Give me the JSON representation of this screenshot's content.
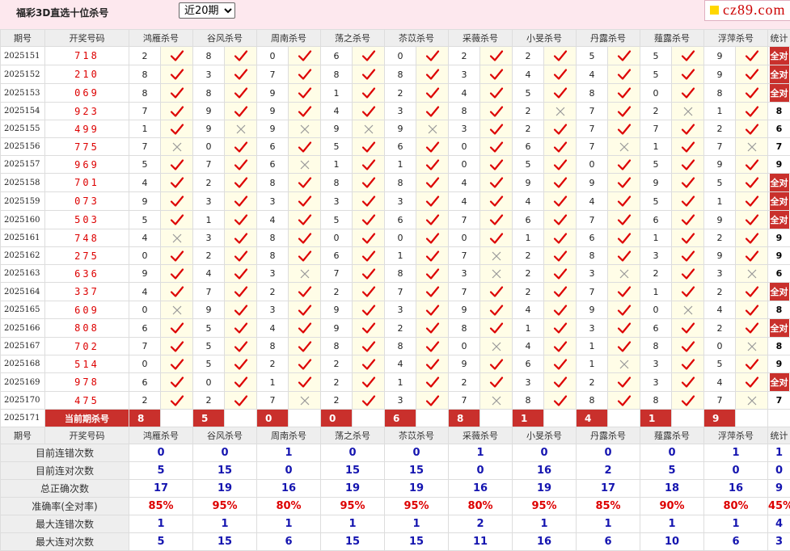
{
  "page": {
    "title": "福彩3D直选十位杀号",
    "period_selected": "近20期",
    "site_logo": "cz89.com"
  },
  "headers": {
    "period": "期号",
    "numbers": "开奖号码",
    "stat": "统计"
  },
  "experts": [
    "鸿雁杀号",
    "谷风杀号",
    "周南杀号",
    "荡之杀号",
    "苶苡杀号",
    "采薇杀号",
    "小旻杀号",
    "丹露杀号",
    "薤露杀号",
    "浮萍杀号"
  ],
  "status_full": "全对",
  "rows": [
    {
      "period": "2025151",
      "numbers": "718",
      "kills": [
        2,
        8,
        0,
        6,
        0,
        2,
        2,
        5,
        5,
        9
      ],
      "hits": [
        1,
        1,
        1,
        1,
        1,
        1,
        1,
        1,
        1,
        1
      ],
      "stat": "全对"
    },
    {
      "period": "2025152",
      "numbers": "210",
      "kills": [
        8,
        3,
        7,
        8,
        8,
        3,
        4,
        4,
        5,
        9
      ],
      "hits": [
        1,
        1,
        1,
        1,
        1,
        1,
        1,
        1,
        1,
        1
      ],
      "stat": "全对"
    },
    {
      "period": "2025153",
      "numbers": "069",
      "kills": [
        8,
        8,
        9,
        1,
        2,
        4,
        5,
        8,
        0,
        8
      ],
      "hits": [
        1,
        1,
        1,
        1,
        1,
        1,
        1,
        1,
        1,
        1
      ],
      "stat": "全对"
    },
    {
      "period": "2025154",
      "numbers": "923",
      "kills": [
        7,
        9,
        9,
        4,
        3,
        8,
        2,
        7,
        2,
        1
      ],
      "hits": [
        1,
        1,
        1,
        1,
        1,
        1,
        0,
        1,
        0,
        1
      ],
      "stat": "8"
    },
    {
      "period": "2025155",
      "numbers": "499",
      "kills": [
        1,
        9,
        9,
        9,
        9,
        3,
        2,
        7,
        7,
        2
      ],
      "hits": [
        1,
        0,
        0,
        0,
        0,
        1,
        1,
        1,
        1,
        1
      ],
      "stat": "6"
    },
    {
      "period": "2025156",
      "numbers": "775",
      "kills": [
        7,
        0,
        6,
        5,
        6,
        0,
        6,
        7,
        1,
        7
      ],
      "hits": [
        0,
        1,
        1,
        1,
        1,
        1,
        1,
        0,
        1,
        0
      ],
      "stat": "7"
    },
    {
      "period": "2025157",
      "numbers": "969",
      "kills": [
        5,
        7,
        6,
        1,
        1,
        0,
        5,
        0,
        5,
        9
      ],
      "hits": [
        1,
        1,
        0,
        1,
        1,
        1,
        1,
        1,
        1,
        1
      ],
      "stat": "9"
    },
    {
      "period": "2025158",
      "numbers": "701",
      "kills": [
        4,
        2,
        8,
        8,
        8,
        4,
        9,
        9,
        9,
        5
      ],
      "hits": [
        1,
        1,
        1,
        1,
        1,
        1,
        1,
        1,
        1,
        1
      ],
      "stat": "全对"
    },
    {
      "period": "2025159",
      "numbers": "073",
      "kills": [
        9,
        3,
        3,
        3,
        3,
        4,
        4,
        4,
        5,
        1
      ],
      "hits": [
        1,
        1,
        1,
        1,
        1,
        1,
        1,
        1,
        1,
        1
      ],
      "stat": "全对"
    },
    {
      "period": "2025160",
      "numbers": "503",
      "kills": [
        5,
        1,
        4,
        5,
        6,
        7,
        6,
        7,
        6,
        9
      ],
      "hits": [
        1,
        1,
        1,
        1,
        1,
        1,
        1,
        1,
        1,
        1
      ],
      "stat": "全对"
    },
    {
      "period": "2025161",
      "numbers": "748",
      "kills": [
        4,
        3,
        8,
        0,
        0,
        0,
        1,
        6,
        1,
        2
      ],
      "hits": [
        0,
        1,
        1,
        1,
        1,
        1,
        1,
        1,
        1,
        1
      ],
      "stat": "9"
    },
    {
      "period": "2025162",
      "numbers": "275",
      "kills": [
        0,
        2,
        8,
        6,
        1,
        7,
        2,
        8,
        3,
        9
      ],
      "hits": [
        1,
        1,
        1,
        1,
        1,
        0,
        1,
        1,
        1,
        1
      ],
      "stat": "9"
    },
    {
      "period": "2025163",
      "numbers": "636",
      "kills": [
        9,
        4,
        3,
        7,
        8,
        3,
        2,
        3,
        2,
        3
      ],
      "hits": [
        1,
        1,
        0,
        1,
        1,
        0,
        1,
        0,
        1,
        0
      ],
      "stat": "6"
    },
    {
      "period": "2025164",
      "numbers": "337",
      "kills": [
        4,
        7,
        2,
        2,
        7,
        7,
        2,
        7,
        1,
        2
      ],
      "hits": [
        1,
        1,
        1,
        1,
        1,
        1,
        1,
        1,
        1,
        1
      ],
      "stat": "全对"
    },
    {
      "period": "2025165",
      "numbers": "609",
      "kills": [
        0,
        9,
        3,
        9,
        3,
        9,
        4,
        9,
        0,
        4
      ],
      "hits": [
        0,
        1,
        1,
        1,
        1,
        1,
        1,
        1,
        0,
        1
      ],
      "stat": "8"
    },
    {
      "period": "2025166",
      "numbers": "808",
      "kills": [
        6,
        5,
        4,
        9,
        2,
        8,
        1,
        3,
        6,
        2
      ],
      "hits": [
        1,
        1,
        1,
        1,
        1,
        1,
        1,
        1,
        1,
        1
      ],
      "stat": "全对"
    },
    {
      "period": "2025167",
      "numbers": "702",
      "kills": [
        7,
        5,
        8,
        8,
        8,
        0,
        4,
        1,
        8,
        0
      ],
      "hits": [
        1,
        1,
        1,
        1,
        1,
        0,
        1,
        1,
        1,
        0
      ],
      "stat": "8"
    },
    {
      "period": "2025168",
      "numbers": "514",
      "kills": [
        0,
        5,
        2,
        2,
        4,
        9,
        6,
        1,
        3,
        5
      ],
      "hits": [
        1,
        1,
        1,
        1,
        1,
        1,
        1,
        0,
        1,
        1
      ],
      "stat": "9"
    },
    {
      "period": "2025169",
      "numbers": "978",
      "kills": [
        6,
        0,
        1,
        2,
        1,
        2,
        3,
        2,
        3,
        4
      ],
      "hits": [
        1,
        1,
        1,
        1,
        1,
        1,
        1,
        1,
        1,
        1
      ],
      "stat": "全对"
    },
    {
      "period": "2025170",
      "numbers": "475",
      "kills": [
        2,
        2,
        7,
        2,
        3,
        7,
        8,
        8,
        8,
        7
      ],
      "hits": [
        1,
        1,
        0,
        1,
        1,
        0,
        1,
        1,
        1,
        0
      ],
      "stat": "7"
    }
  ],
  "current": {
    "period": "2025171",
    "label": "当前期杀号",
    "kills": [
      8,
      5,
      0,
      0,
      6,
      8,
      1,
      4,
      1,
      9
    ]
  },
  "summary": [
    {
      "label": "目前连错次数",
      "values": [
        "0",
        "0",
        "1",
        "0",
        "0",
        "1",
        "0",
        "0",
        "0",
        "1",
        "1"
      ],
      "color": "blue"
    },
    {
      "label": "目前连对次数",
      "values": [
        "5",
        "15",
        "0",
        "15",
        "15",
        "0",
        "16",
        "2",
        "5",
        "0",
        "0"
      ],
      "color": "blue"
    },
    {
      "label": "总正确次数",
      "values": [
        "17",
        "19",
        "16",
        "19",
        "19",
        "16",
        "19",
        "17",
        "18",
        "16",
        "9"
      ],
      "color": "blue"
    },
    {
      "label": "准确率(全对率)",
      "values": [
        "85%",
        "95%",
        "80%",
        "95%",
        "95%",
        "80%",
        "95%",
        "85%",
        "90%",
        "80%",
        "45%"
      ],
      "color": "red"
    },
    {
      "label": "最大连错次数",
      "values": [
        "1",
        "1",
        "1",
        "1",
        "1",
        "2",
        "1",
        "1",
        "1",
        "1",
        "4"
      ],
      "color": "blue"
    },
    {
      "label": "最大连对次数",
      "values": [
        "5",
        "15",
        "6",
        "15",
        "15",
        "11",
        "16",
        "6",
        "10",
        "6",
        "3"
      ],
      "color": "blue"
    }
  ],
  "colors": {
    "accent_red": "#c9302c",
    "num_red": "#dd0000",
    "stat_blue": "#1515b0",
    "header_bg": "#eeeeee",
    "mark_bg": "#fffde7"
  },
  "icons": {
    "hit": "check-icon",
    "miss": "cross-icon"
  }
}
